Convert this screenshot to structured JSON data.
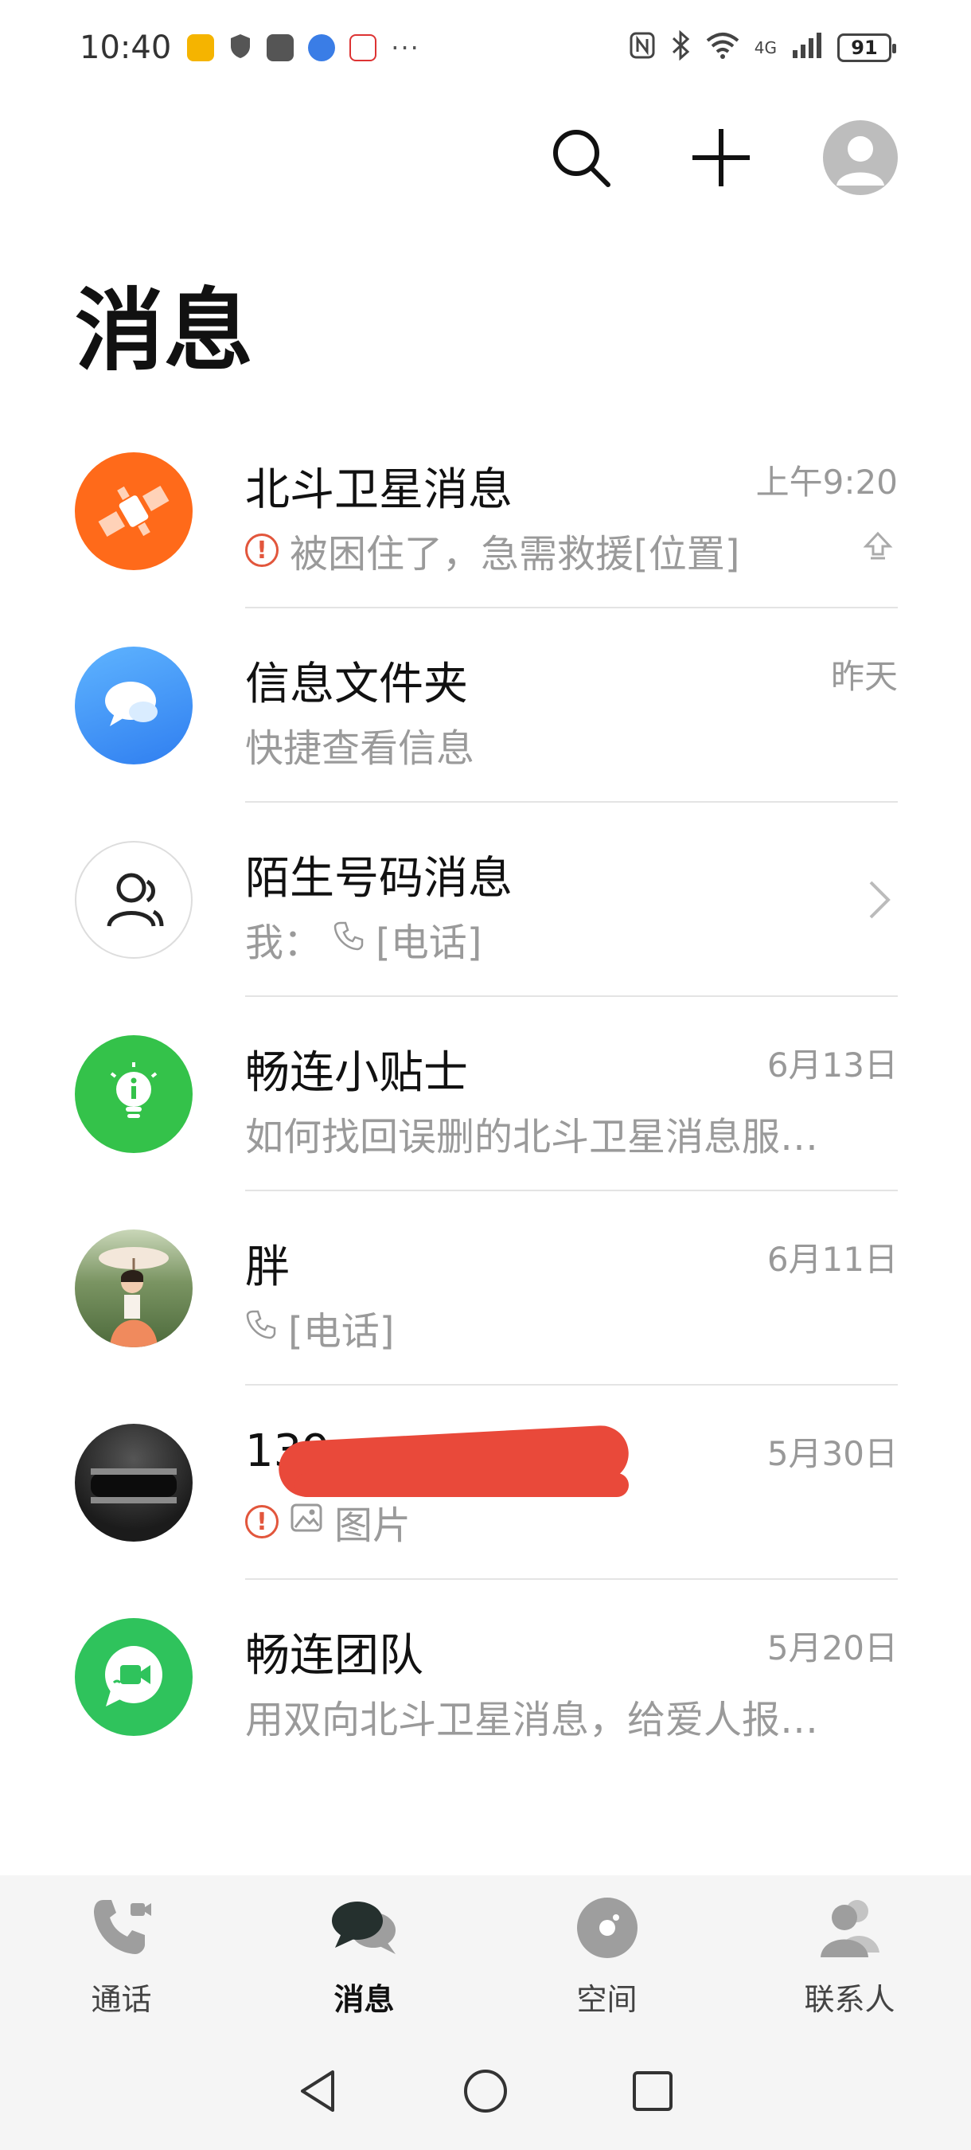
{
  "status_bar": {
    "time": "10:40",
    "battery": "91",
    "dots": "···",
    "net": "4G"
  },
  "page": {
    "title": "消息"
  },
  "conversations": [
    {
      "name": "北斗卫星消息",
      "time": "上午9:20",
      "preview": "被困住了，急需救援[位置]",
      "avatar_color": "#ff6a1a"
    },
    {
      "name": "信息文件夹",
      "time": "昨天",
      "preview": "快捷查看信息",
      "avatar_color": "#3b8ef0"
    },
    {
      "name": "陌生号码消息",
      "time": "",
      "preview_prefix": "我：",
      "preview": "[电话]",
      "avatar_color": "#ffffff"
    },
    {
      "name": "畅连小贴士",
      "time": "6月13日",
      "preview": "如何找回误删的北斗卫星消息服…",
      "avatar_color": "#34c24a"
    },
    {
      "name": "胖",
      "time": "6月11日",
      "preview": "[电话]",
      "avatar_color": "#6a8a5a"
    },
    {
      "name": "139",
      "time": "5月30日",
      "preview": "图片",
      "avatar_color": "#222222"
    },
    {
      "name": "畅连团队",
      "time": "5月20日",
      "preview": "用双向北斗卫星消息，给爱人报…",
      "avatar_color": "#2fc35c"
    }
  ],
  "bottom_nav": {
    "tabs": [
      {
        "label": "通话"
      },
      {
        "label": "消息"
      },
      {
        "label": "空间"
      },
      {
        "label": "联系人"
      }
    ]
  }
}
